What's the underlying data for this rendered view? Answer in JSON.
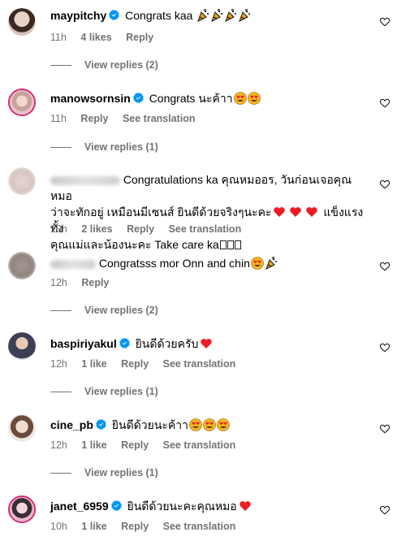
{
  "comments": [
    {
      "username": "maypitchy",
      "text": "Congrats kaa",
      "time": "11h",
      "likes": "4 likes",
      "reply": "Reply",
      "translation": "",
      "view_replies": "View replies (2)"
    },
    {
      "username": "manowsornsin",
      "text": "Congrats นะค้าา",
      "time": "11h",
      "likes": "",
      "reply": "Reply",
      "translation": "See translation",
      "view_replies": "View replies (1)"
    },
    {
      "username": "",
      "text_line1": "Congratulations ka คุณหมออร, วันก่อนเจอคุณหมอ",
      "text_line2a": "ว่าจะทักอยู่ เหมือนมีเซนส์ ยินดีด้วยจริงๆนะคะ",
      "text_line2b": "แข็งแรงทั้ง",
      "text_line3": "คุณแม่และน้องนะคะ Take care ka",
      "time": "10h",
      "likes": "2 likes",
      "reply": "Reply",
      "translation": "See translation",
      "view_replies": ""
    },
    {
      "username": "",
      "text": "Congratsss mor Onn and chin",
      "time": "12h",
      "likes": "",
      "reply": "Reply",
      "translation": "",
      "view_replies": "View replies (2)"
    },
    {
      "username": "baspiriyakul",
      "text": "ยินดีด้วยครับ",
      "time": "12h",
      "likes": "1 like",
      "reply": "Reply",
      "translation": "See translation",
      "view_replies": "View replies (1)"
    },
    {
      "username": "cine_pb",
      "text": "ยินดีด้วยนะค้าา",
      "time": "12h",
      "likes": "1 like",
      "reply": "Reply",
      "translation": "See translation",
      "view_replies": "View replies (1)"
    },
    {
      "username": "janet_6959",
      "text": "ยินดีด้วยนะคะคุณหมอ",
      "time": "10h",
      "likes": "1 like",
      "reply": "Reply",
      "translation": "See translation",
      "view_replies": ""
    }
  ],
  "colors": {
    "verified": "#0095f6",
    "meta": "#737373",
    "heart_red": "#ed1c24",
    "story_ring": "#d62976"
  },
  "icons": [
    "verified-badge-icon",
    "party-popper-icon",
    "heart-eyes-emoji-icon",
    "red-heart-emoji-icon",
    "like-heart-icon"
  ]
}
